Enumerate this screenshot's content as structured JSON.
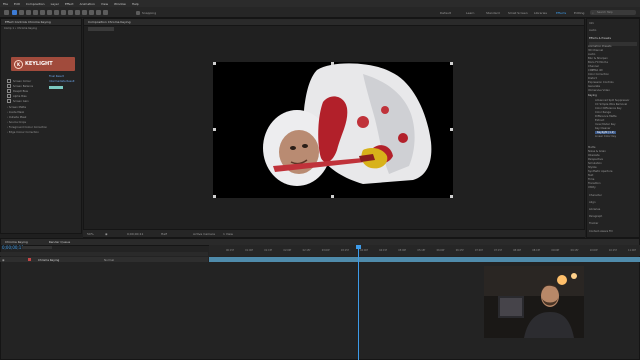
{
  "menu": [
    "File",
    "Edit",
    "Composition",
    "Layer",
    "Effect",
    "Animation",
    "View",
    "Window",
    "Help"
  ],
  "toolbar": {
    "snapping_label": "Snapping",
    "workspaces": [
      "Default",
      "Learn",
      "Standard",
      "Small Screen",
      "Libraries",
      "Effects",
      "Editing"
    ],
    "active_workspace": "Effects",
    "search_placeholder": "Search Help"
  },
  "effect_controls": {
    "tab": "Effect Controls  Chroma Keying",
    "header": "Comp 1 • Chroma Keying",
    "plugin_logo": "KEYLIGHT",
    "items": [
      "Screen Colour",
      "Screen Balance",
      "Despill Bias",
      "Alpha Bias",
      "Screen Gain",
      "Screen Matte",
      "Inside Mask",
      "Outside Mask",
      "Source Crops",
      "Foreground Colour Correction",
      "Edge Colour Correction"
    ],
    "view_label": "Final Result",
    "view_value": "Intermediate Result"
  },
  "composition": {
    "tab": "Composition  Chroma Keying",
    "zoom": "50%",
    "quality": "Half",
    "timecode": "0;00;00;11",
    "camera": "Active Camera",
    "views": "1 View"
  },
  "timeline": {
    "tabs": [
      "Chroma Keying",
      "Render Queue"
    ],
    "timecode": "0;00;00;11",
    "layer_name": "Chroma Keying",
    "layer_mode": "Normal",
    "ticks": [
      "00:15f",
      "01:00f",
      "01:15f",
      "02:00f",
      "02:15f",
      "03:00f",
      "03:15f",
      "04:00f",
      "04:15f",
      "05:00f",
      "05:15f",
      "06:00f",
      "06:15f",
      "07:00f",
      "07:15f",
      "08:00f",
      "08:15f",
      "09:00f",
      "09:15f",
      "10:00f",
      "10:15f",
      "11:00f"
    ]
  },
  "effects_panel": {
    "title": "Effects & Presets",
    "sidebar_tabs": [
      "Info",
      "Audio"
    ],
    "categories": [
      "Animation Presets",
      "3D Channel",
      "Audio",
      "Blur & Sharpen",
      "Boris FX Mocha",
      "Channel",
      "CINEMA 4D",
      "Color Correction",
      "Distort",
      "Expression Controls",
      "Generate",
      "Immersive Video",
      "Keying"
    ],
    "keying_items": [
      "Advanced Spill Suppressor",
      "CC Simple Wire Removal",
      "Color Difference Key",
      "Color Range",
      "Difference Matte",
      "Extract",
      "Inner/Outer Key",
      "Key Cleaner",
      "Keylight (1.2)",
      "Linear Color Key"
    ],
    "selected_item": "Keylight (1.2)",
    "more_categories": [
      "Matte",
      "Noise & Grain",
      "Obsolete",
      "Perspective",
      "Simulation",
      "Stylize",
      "Synthetic Aperture",
      "Text",
      "Time",
      "Transition",
      "Utility"
    ],
    "bottom_panels": [
      "Character",
      "Align",
      "Libraries",
      "Paragraph",
      "Tracker",
      "Content-Aware Fill"
    ]
  }
}
